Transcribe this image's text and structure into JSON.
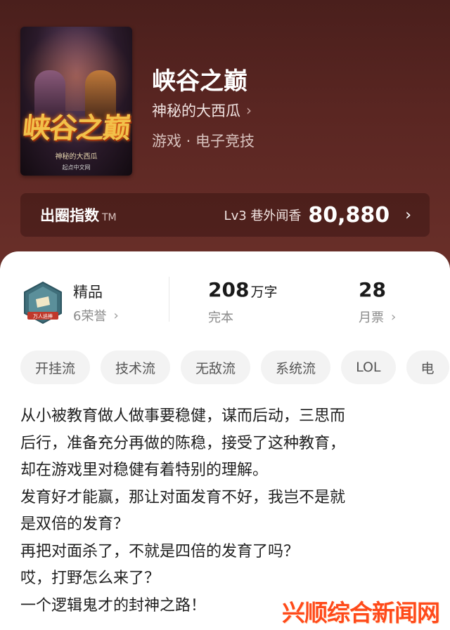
{
  "book": {
    "title": "峡谷之巅",
    "author": "神秘的大西瓜",
    "author_chevron": "›",
    "genre": "游戏 · 电子竞技",
    "cover": {
      "title": "峡谷之巅",
      "author": "神秘的大西瓜",
      "site": "起点中文网"
    }
  },
  "circle_index": {
    "label": "出圈指数",
    "tm": "TM",
    "level": "Lv3 巷外闻香",
    "value": "80,880",
    "chevron": "›"
  },
  "stats": {
    "honor": {
      "title": "精品",
      "sub": "6荣誉",
      "badge_text": "万人追捧"
    },
    "words": {
      "value": "208",
      "unit": "万字",
      "sub": "完本"
    },
    "votes": {
      "value": "28",
      "sub": "月票"
    },
    "chevron": "›"
  },
  "tags": [
    "开挂流",
    "技术流",
    "无敌流",
    "系统流",
    "LOL",
    "电"
  ],
  "synopsis": [
    "从小被教育做人做事要稳健，谋而后动，三思而",
    "后行，准备充分再做的陈稳，接受了这种教育，",
    "却在游戏里对稳健有着特别的理解。",
    "发育好才能赢，那让对面发育不好，我岂不是就",
    "是双倍的发育？",
    "再把对面杀了，不就是四倍的发育了吗？",
    "哎，打野怎么来了？",
    "一个逻辑鬼才的封神之路！"
  ],
  "watermark": "兴顺综合新闻网",
  "colors": {
    "hero_bg": "#5a2622",
    "watermark": "#ff4a1a"
  }
}
